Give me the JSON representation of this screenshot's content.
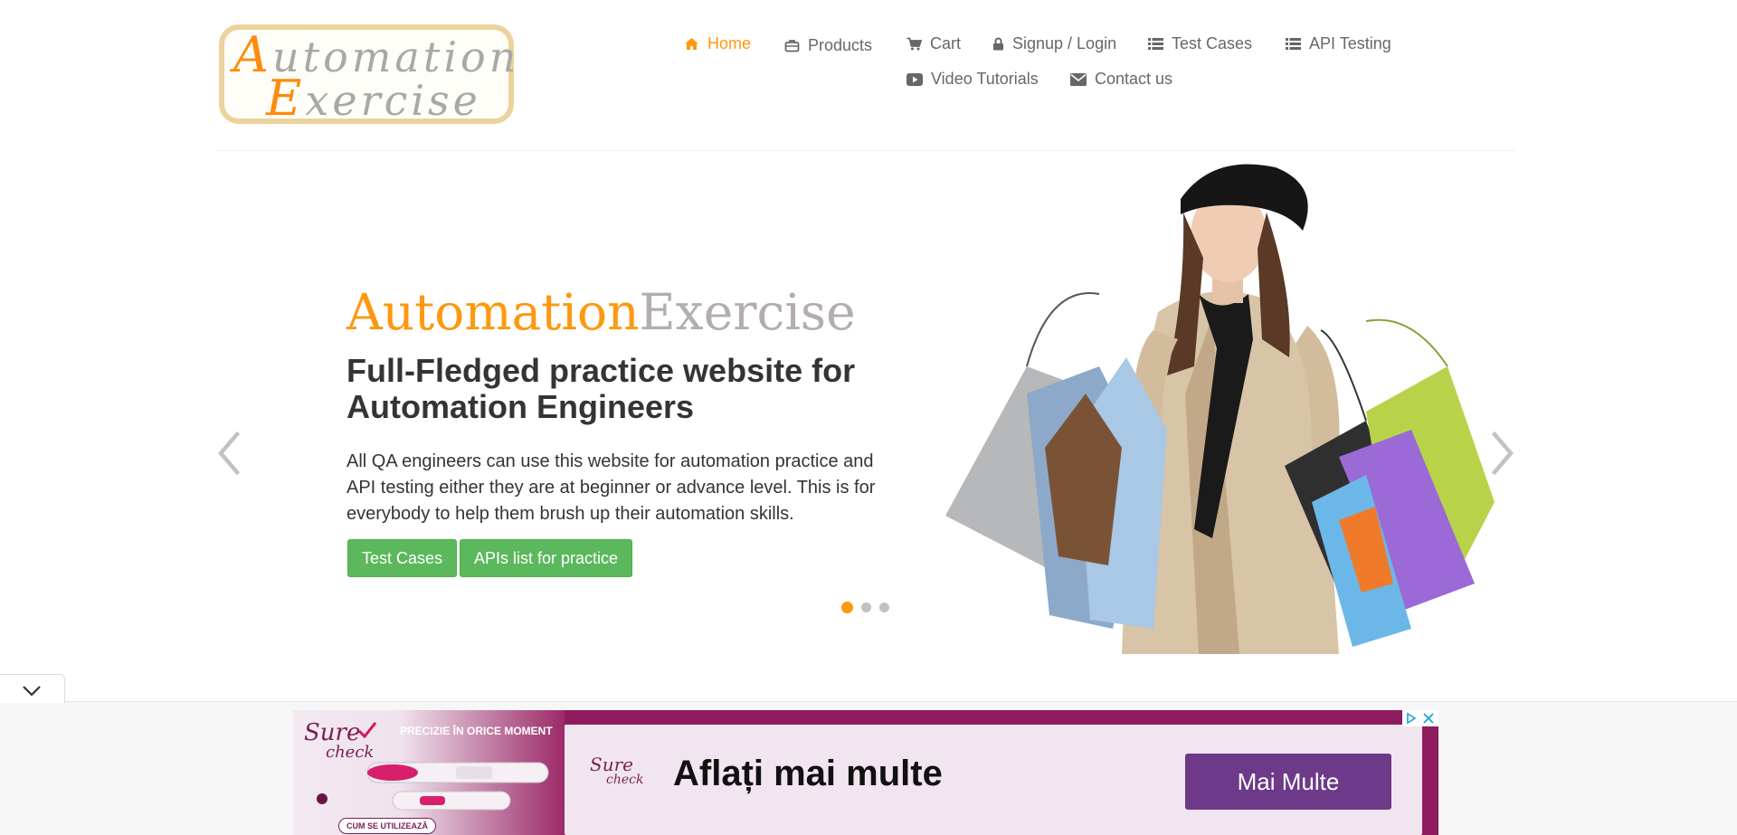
{
  "logo": {
    "line1_cap": "A",
    "line1_rest": "utomation",
    "line2_cap": "E",
    "line2_rest": "xercise"
  },
  "nav": {
    "items": [
      {
        "label": "Home",
        "icon": "home-icon",
        "active": true
      },
      {
        "label": "Products",
        "icon": "products-icon"
      },
      {
        "label": "Cart",
        "icon": "cart-icon"
      },
      {
        "label": "Signup / Login",
        "icon": "lock-icon"
      },
      {
        "label": "Test Cases",
        "icon": "list-icon"
      },
      {
        "label": "API Testing",
        "icon": "list-icon"
      },
      {
        "label": "Video Tutorials",
        "icon": "youtube-icon"
      },
      {
        "label": "Contact us",
        "icon": "envelope-icon"
      }
    ]
  },
  "slider": {
    "brand_part1": "Automation",
    "brand_part2": "Exercise",
    "headline": "Full-Fledged practice website for Automation Engineers",
    "description": "All QA engineers can use this website for automation practice and API testing either they are at beginner or advance level. This is for everybody to help them brush up their automation skills.",
    "buttons": {
      "test_cases": "Test Cases",
      "apis_list": "APIs list for practice"
    },
    "slide_count": 3,
    "active_slide": 1,
    "prev_icon": "chevron-left-icon",
    "next_icon": "chevron-right-icon",
    "image": "woman-with-shopping-bags"
  },
  "ad": {
    "collapse_icon": "chevron-down-icon",
    "brand_word1": "Sure",
    "brand_word2": "check",
    "slogan": "PRECIZIE ÎN ORICE MOMENT",
    "how_to": "CUM SE UTILIZEAZĂ",
    "headline": "Aflați mai multe",
    "cta": "Mai Multe",
    "choices_icons": [
      "adchoices-icon",
      "close-icon"
    ]
  },
  "colors": {
    "accent": "#fe980f",
    "button_green": "#5cb85c",
    "headline_text": "#363432",
    "nav_text": "#696763",
    "ad_purple": "#8e1c5e",
    "ad_button": "#6c3a88"
  }
}
